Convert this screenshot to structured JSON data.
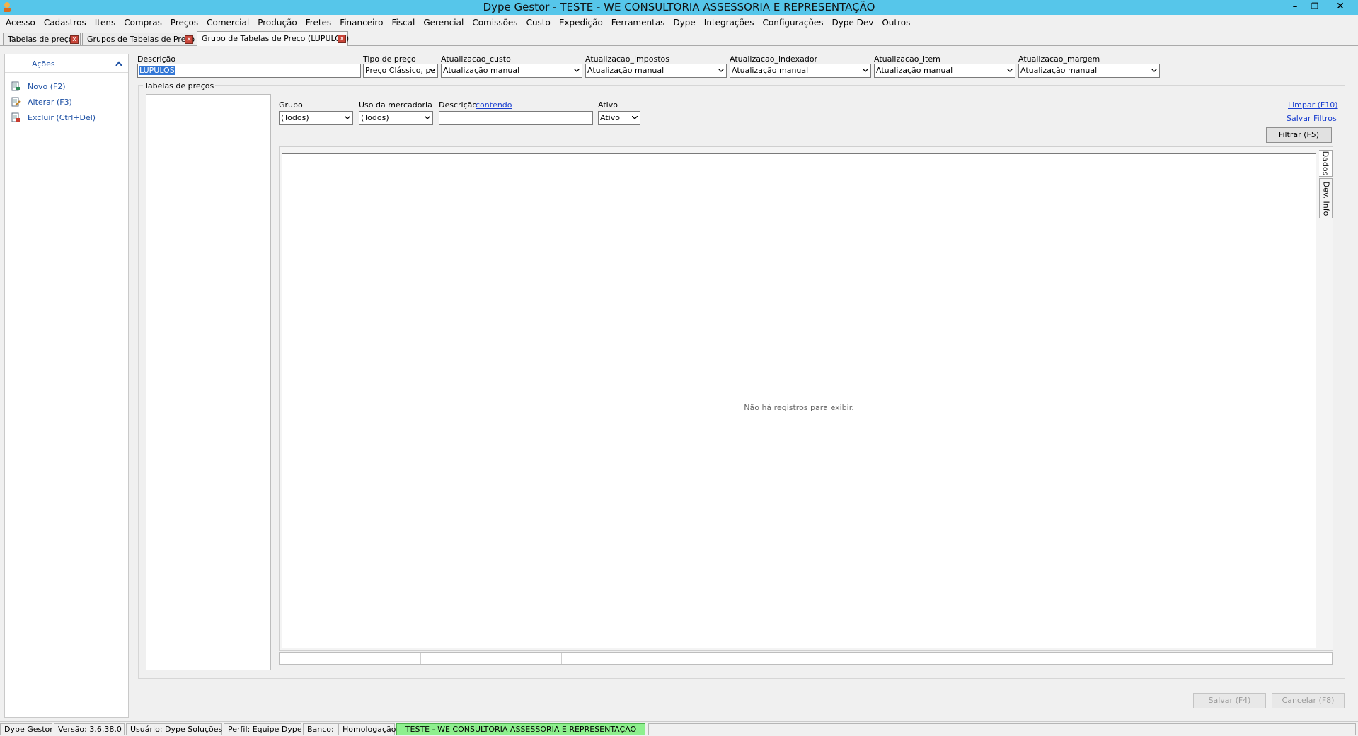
{
  "window": {
    "title": "Dype Gestor - TESTE - WE CONSULTORIA ASSESSORIA E REPRESENTAÇÃO"
  },
  "menu": [
    "Acesso",
    "Cadastros",
    "Itens",
    "Compras",
    "Preços",
    "Comercial",
    "Produção",
    "Fretes",
    "Financeiro",
    "Fiscal",
    "Gerencial",
    "Comissões",
    "Custo",
    "Expedição",
    "Ferramentas",
    "Dype",
    "Integrações",
    "Configurações",
    "Dype Dev",
    "Outros"
  ],
  "tabs": [
    {
      "label": "Tabelas de preço"
    },
    {
      "label": "Grupos de Tabelas de Preço"
    },
    {
      "label": "Grupo de Tabelas de Preço (LUPULOS)"
    }
  ],
  "actions": {
    "header": "Ações",
    "items": [
      {
        "label": "Novo (F2)"
      },
      {
        "label": "Alterar (F3)"
      },
      {
        "label": "Excluir (Ctrl+Del)"
      }
    ]
  },
  "form": {
    "descricao": {
      "label": "Descrição",
      "value": "LUPULOS"
    },
    "tipo_preco": {
      "label": "Tipo de preço",
      "value": "Preço Clássico, pe"
    },
    "atualizacao_custo": {
      "label": "Atualizacao_custo",
      "value": "Atualização manual"
    },
    "atualizacao_impostos": {
      "label": "Atualizacao_impostos",
      "value": "Atualização manual"
    },
    "atualizacao_indexador": {
      "label": "Atualizacao_indexador",
      "value": "Atualização manual"
    },
    "atualizacao_item": {
      "label": "Atualizacao_item",
      "value": "Atualização manual"
    },
    "atualizacao_margem": {
      "label": "Atualizacao_margem",
      "value": "Atualização manual"
    }
  },
  "tabelas": {
    "group_label": "Tabelas de preços",
    "filters": {
      "grupo": {
        "label": "Grupo",
        "value": "(Todos)"
      },
      "uso": {
        "label": "Uso da mercadoria",
        "value": "(Todos)"
      },
      "descricao": {
        "label": "Descrição",
        "link": "contendo",
        "value": ""
      },
      "ativo": {
        "label": "Ativo",
        "value": "Ativo"
      }
    },
    "limpar": "Limpar (F10)",
    "salvar_filtros": "Salvar Filtros",
    "filtrar": "Filtrar (F5)",
    "empty_message": "Não há registros para exibir.",
    "side_tabs": [
      "Dados",
      "Dev. Info"
    ]
  },
  "buttons": {
    "salvar": "Salvar (F4)",
    "cancelar": "Cancelar (F8)"
  },
  "statusbar": {
    "app": "Dype Gestor",
    "versao": "Versão: 3.6.38.0",
    "usuario": "Usuário: Dype Soluções",
    "perfil": "Perfil: Equipe Dype",
    "banco": "Banco:",
    "ambiente": "Homologação",
    "empresa": "TESTE - WE CONSULTORIA ASSESSORIA E REPRESENTAÇÃO"
  },
  "colors": {
    "titlebar": "#56c6ea",
    "link": "#1a3fd0",
    "env_badge": "#8ef08e",
    "selection": "#3377d6"
  }
}
